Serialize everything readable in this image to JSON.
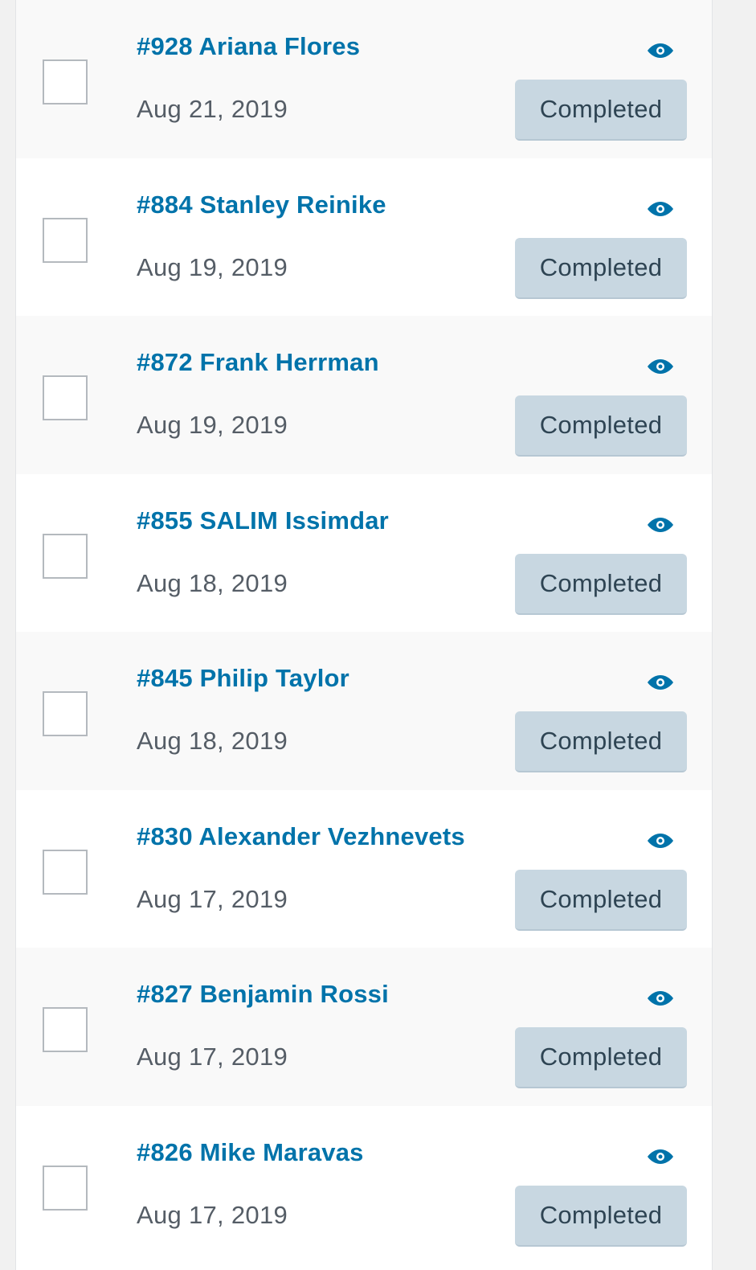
{
  "colors": {
    "link": "#0073aa",
    "date_text": "#555d66",
    "badge_bg": "#c8d7e1",
    "badge_text": "#2e4453",
    "row_alt_bg": "#f9f9f9",
    "row_bg": "#ffffff"
  },
  "icons": {
    "checkbox": "checkbox",
    "preview": "eye-icon"
  },
  "orders": [
    {
      "title": "#928 Ariana Flores",
      "date": "Aug 21, 2019",
      "status": "Completed"
    },
    {
      "title": "#884 Stanley Reinike",
      "date": "Aug 19, 2019",
      "status": "Completed"
    },
    {
      "title": "#872 Frank Herrman",
      "date": "Aug 19, 2019",
      "status": "Completed"
    },
    {
      "title": "#855 SALIM Issimdar",
      "date": "Aug 18, 2019",
      "status": "Completed"
    },
    {
      "title": "#845 Philip Taylor",
      "date": "Aug 18, 2019",
      "status": "Completed"
    },
    {
      "title": "#830 Alexander Vezhnevets",
      "date": "Aug 17, 2019",
      "status": "Completed"
    },
    {
      "title": "#827 Benjamin Rossi",
      "date": "Aug 17, 2019",
      "status": "Completed"
    },
    {
      "title": "#826 Mike Maravas",
      "date": "Aug 17, 2019",
      "status": "Completed"
    }
  ]
}
